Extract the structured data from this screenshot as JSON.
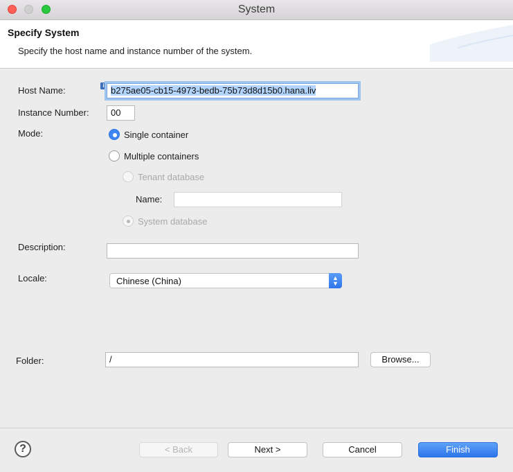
{
  "window": {
    "title": "System"
  },
  "banner": {
    "title": "Specify System",
    "subtitle": "Specify the host name and instance number of the system."
  },
  "form": {
    "host_name": {
      "label": "Host Name:",
      "value": "b275ae05-cb15-4973-bedb-75b73d8d15b0.hana.liv"
    },
    "instance_number": {
      "label": "Instance Number:",
      "value": "00"
    },
    "mode": {
      "label": "Mode:",
      "single_container": {
        "label": "Single container",
        "selected": true
      },
      "multiple_containers": {
        "label": "Multiple containers",
        "selected": false
      },
      "tenant_database": {
        "label": "Tenant database",
        "enabled": false
      },
      "name": {
        "label": "Name:",
        "value": ""
      },
      "system_database": {
        "label": "System database",
        "enabled": false
      }
    },
    "description": {
      "label": "Description:",
      "value": ""
    },
    "locale": {
      "label": "Locale:",
      "selected": "Chinese (China)"
    },
    "folder": {
      "label": "Folder:",
      "value": "/",
      "browse_label": "Browse..."
    }
  },
  "footer": {
    "help_glyph": "?",
    "back_label": "< Back",
    "next_label": "Next >",
    "cancel_label": "Cancel",
    "finish_label": "Finish"
  },
  "colors": {
    "accent": "#3d85f5",
    "close": "#fe5f57",
    "maximize": "#28c840"
  }
}
